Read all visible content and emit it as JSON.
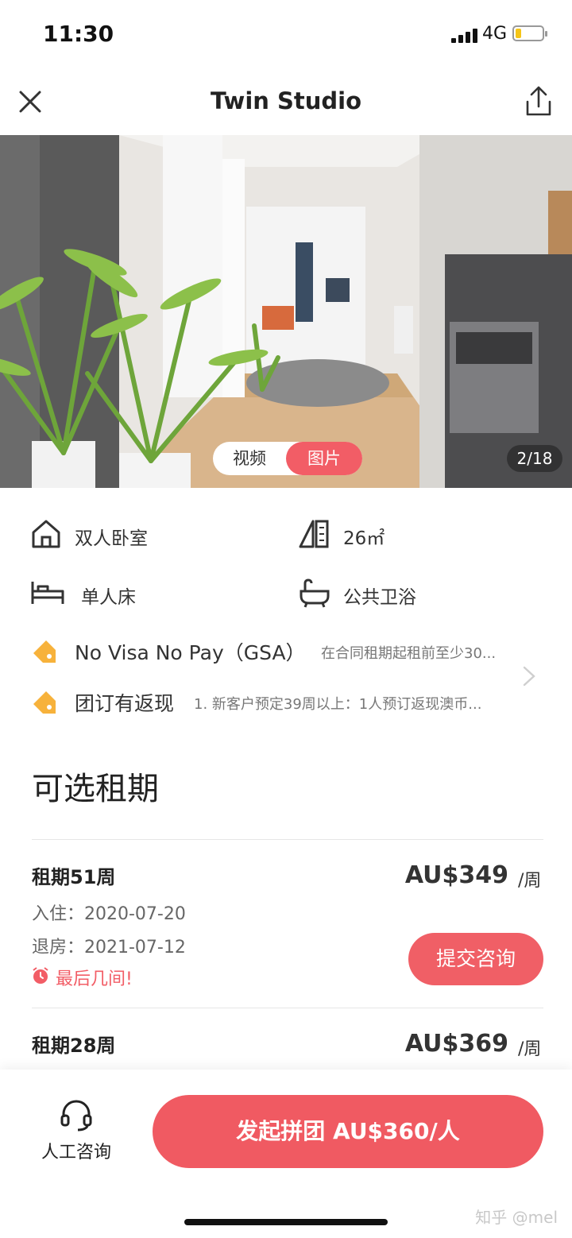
{
  "status_bar": {
    "time": "11:30",
    "network": "4G",
    "battery_level": 0.22,
    "battery_color": "#f5c518"
  },
  "nav": {
    "title": "Twin Studio",
    "close_icon": "close-icon",
    "share_icon": "share-icon"
  },
  "gallery": {
    "video_tab": "视频",
    "photo_tab": "图片",
    "counter": "2/18",
    "accent": "#f25d66"
  },
  "features": {
    "room_type": "双人卧室",
    "area": "26㎡",
    "bed": "单人床",
    "bathroom": "公共卫浴"
  },
  "promotions": [
    {
      "title": "No Visa No Pay（GSA）",
      "desc": "在合同租期起租前至少30...",
      "icon": "tag-icon",
      "color": "#f7b23b"
    },
    {
      "title": "团订有返现",
      "desc": "1. 新客户预定39周以上：1人预订返现澳币...",
      "icon": "tag-icon",
      "color": "#f7b23b"
    }
  ],
  "lease_section": {
    "title": "可选租期",
    "options": [
      {
        "title": "租期51周",
        "price": "AU$349",
        "unit": "/周",
        "check_in": "入住：2020-07-20",
        "check_out": "退房：2021-07-12",
        "scarcity": "最后几间!",
        "button": "提交咨询"
      },
      {
        "title": "租期28周",
        "price": "AU$369",
        "unit": "/周"
      }
    ]
  },
  "bottom_bar": {
    "agent_label": "人工咨询",
    "group_button": "发起拼团 AU$360/人",
    "brand_color": "#f05a62"
  },
  "watermark": "知乎 @mel"
}
